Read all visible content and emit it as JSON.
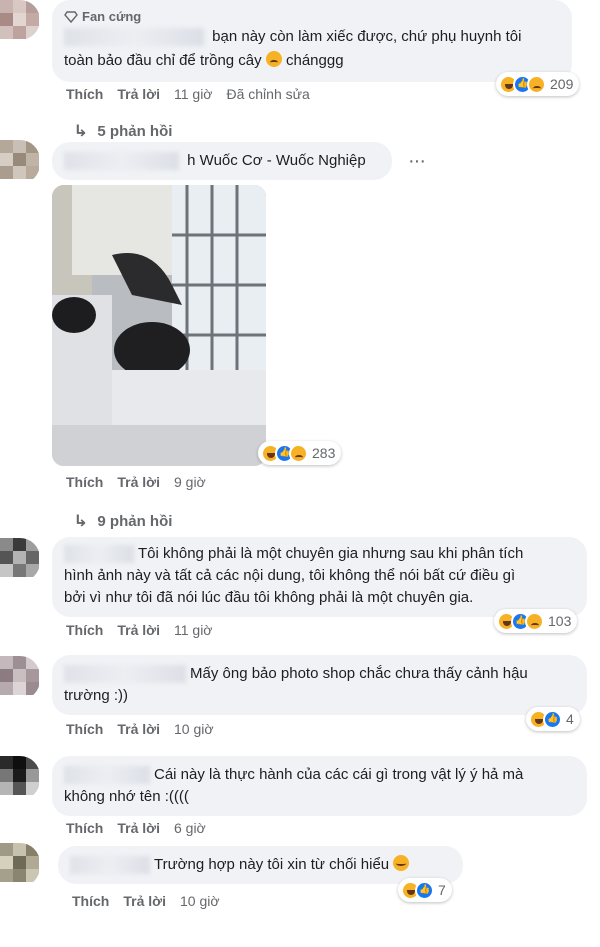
{
  "labels": {
    "fan_badge": "Fan cứng",
    "like": "Thích",
    "reply": "Trả lời",
    "edited": "Đã chỉnh sửa",
    "more": "···"
  },
  "comments": [
    {
      "id": "c1",
      "text_line1": "bạn này còn làm xiếc được, chứ phụ huynh tôi",
      "text_line2": "toàn bảo đầu chỉ để trồng cây",
      "text_tail": "chánggg",
      "time": "11 giờ",
      "reaction_count": "209",
      "replies": "5 phản hồi"
    },
    {
      "id": "c2",
      "name_visible": "h Wuốc Cơ - Wuốc Nghiệp",
      "time": "9 giờ",
      "reaction_count": "283",
      "replies": "9 phản hồi"
    },
    {
      "id": "c3",
      "text_line1": "Tôi không phải là một chuyên gia nhưng sau khi phân tích",
      "text_line2": "hình ảnh này và tất cả các nội dung, tôi không thể nói bất cứ điều gì",
      "text_line3": "bởi vì như tôi đã nói lúc đầu tôi không phải là một chuyên gia.",
      "time": "11 giờ",
      "reaction_count": "103"
    },
    {
      "id": "c4",
      "text_line1": "Mấy ông bảo photo shop chắc chưa thấy cảnh hậu",
      "text_line2": "trường :))",
      "time": "10 giờ",
      "reaction_count": "4"
    },
    {
      "id": "c5",
      "text_line1": "Cái này là thực hành của các cái gì trong vật lý ý hả mà",
      "text_line2": "không nhớ tên :((((",
      "time": "6 giờ"
    },
    {
      "id": "c6",
      "text_line1": "Trường hợp này tôi xin từ chối hiểu",
      "time": "10 giờ",
      "reaction_count": "7"
    }
  ],
  "colors": {
    "bubble": "#f0f2f5",
    "meta_text": "#65676b",
    "like_blue": "#1877f2",
    "haha_yellow": "#f7b125"
  }
}
